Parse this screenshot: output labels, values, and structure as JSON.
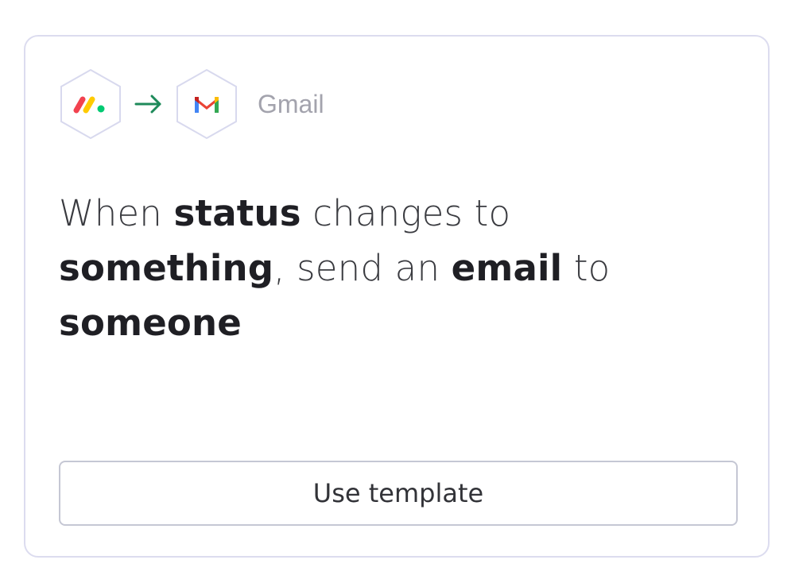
{
  "card": {
    "source_icon": "monday-logo-icon",
    "arrow_icon": "arrow-right-icon",
    "target_icon": "gmail-icon",
    "service_name": "Gmail",
    "sentence": [
      {
        "text": "When ",
        "bold": false
      },
      {
        "text": "status",
        "bold": true
      },
      {
        "text": " changes to ",
        "bold": false
      },
      {
        "text": "something",
        "bold": true
      },
      {
        "text": ", send an ",
        "bold": false
      },
      {
        "text": "email",
        "bold": true
      },
      {
        "text": " to ",
        "bold": false
      },
      {
        "text": "someone",
        "bold": true
      }
    ],
    "button_label": "Use template"
  },
  "colors": {
    "card_border": "#dcdcef",
    "arrow": "#1e8a5a",
    "monday_red": "#f2424f",
    "monday_yellow": "#ffcb00",
    "monday_green": "#00ca72",
    "text_dark": "#323338",
    "service_gray": "#a3a3ad"
  }
}
